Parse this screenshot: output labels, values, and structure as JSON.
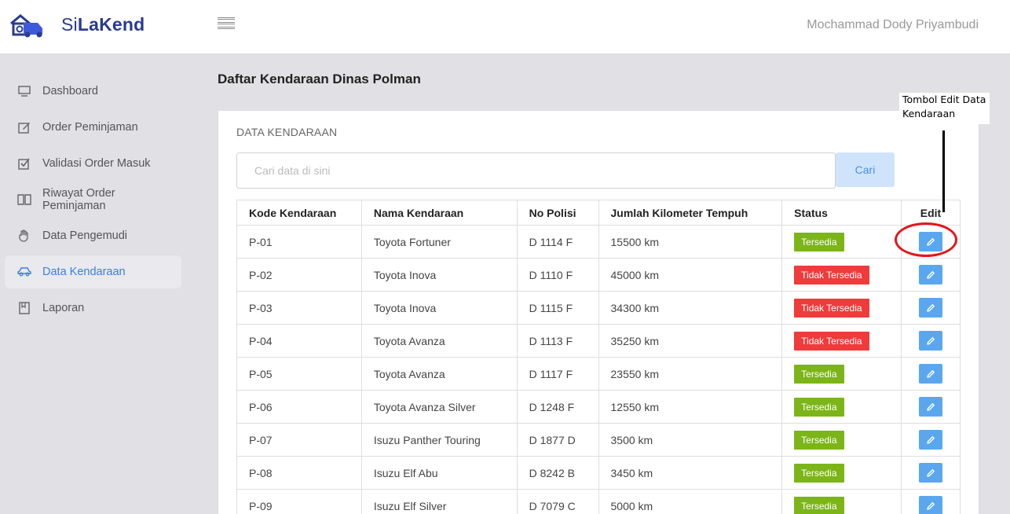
{
  "header": {
    "brand_part1": "Si",
    "brand_part2": "LaKend",
    "username": "Mochammad Dody Priyambudi"
  },
  "sidebar": {
    "items": [
      {
        "label": "Dashboard",
        "icon": "monitor-icon",
        "active": false
      },
      {
        "label": "Order Peminjaman",
        "icon": "edit-form-icon",
        "active": false
      },
      {
        "label": "Validasi Order Masuk",
        "icon": "checkbox-icon",
        "active": false
      },
      {
        "label": "Riwayat Order Peminjaman",
        "icon": "book-icon",
        "active": false
      },
      {
        "label": "Data Pengemudi",
        "icon": "hand-icon",
        "active": false
      },
      {
        "label": "Data Kendaraan",
        "icon": "car-icon",
        "active": true
      },
      {
        "label": "Laporan",
        "icon": "report-icon",
        "active": false
      }
    ]
  },
  "main": {
    "title": "Daftar Kendaraan Dinas Polman",
    "card_title": "DATA KENDARAAN",
    "search": {
      "placeholder": "Cari data di sini",
      "value": "",
      "button_label": "Cari"
    },
    "table": {
      "headers": [
        "Kode Kendaraan",
        "Nama Kendaraan",
        "No Polisi",
        "Jumlah Kilometer Tempuh",
        "Status",
        "Edit"
      ],
      "rows": [
        [
          "P-01",
          "Toyota Fortuner",
          "D 1114 F",
          "15500 km",
          "Tersedia"
        ],
        [
          "P-02",
          "Toyota Inova",
          "D 1110 F",
          "45000 km",
          "Tidak Tersedia"
        ],
        [
          "P-03",
          "Toyota Inova",
          "D 1115 F",
          "34300 km",
          "Tidak Tersedia"
        ],
        [
          "P-04",
          "Toyota Avanza",
          "D 1113 F",
          "35250 km",
          "Tidak Tersedia"
        ],
        [
          "P-05",
          "Toyota Avanza",
          "D 1117 F",
          "23550 km",
          "Tersedia"
        ],
        [
          "P-06",
          "Toyota Avanza Silver",
          "D 1248 F",
          "12550 km",
          "Tersedia"
        ],
        [
          "P-07",
          "Isuzu Panther Touring",
          "D 1877 D",
          "3500 km",
          "Tersedia"
        ],
        [
          "P-08",
          "Isuzu Elf Abu",
          "D 8242 B",
          "3450 km",
          "Tersedia"
        ],
        [
          "P-09",
          "Isuzu Elf Silver",
          "D 7079 C",
          "5000 km",
          "Tersedia"
        ]
      ]
    }
  },
  "annotation": {
    "line1": "Tombol Edit Data",
    "line2": "Kendaraan"
  },
  "colors": {
    "brand": "#2a3b8f",
    "active_nav": "#3b7fe0",
    "status_available": "#7cb518",
    "status_unavailable": "#ef3b3b",
    "edit_button": "#5aa7f0",
    "annotation_red": "#e3151c"
  }
}
